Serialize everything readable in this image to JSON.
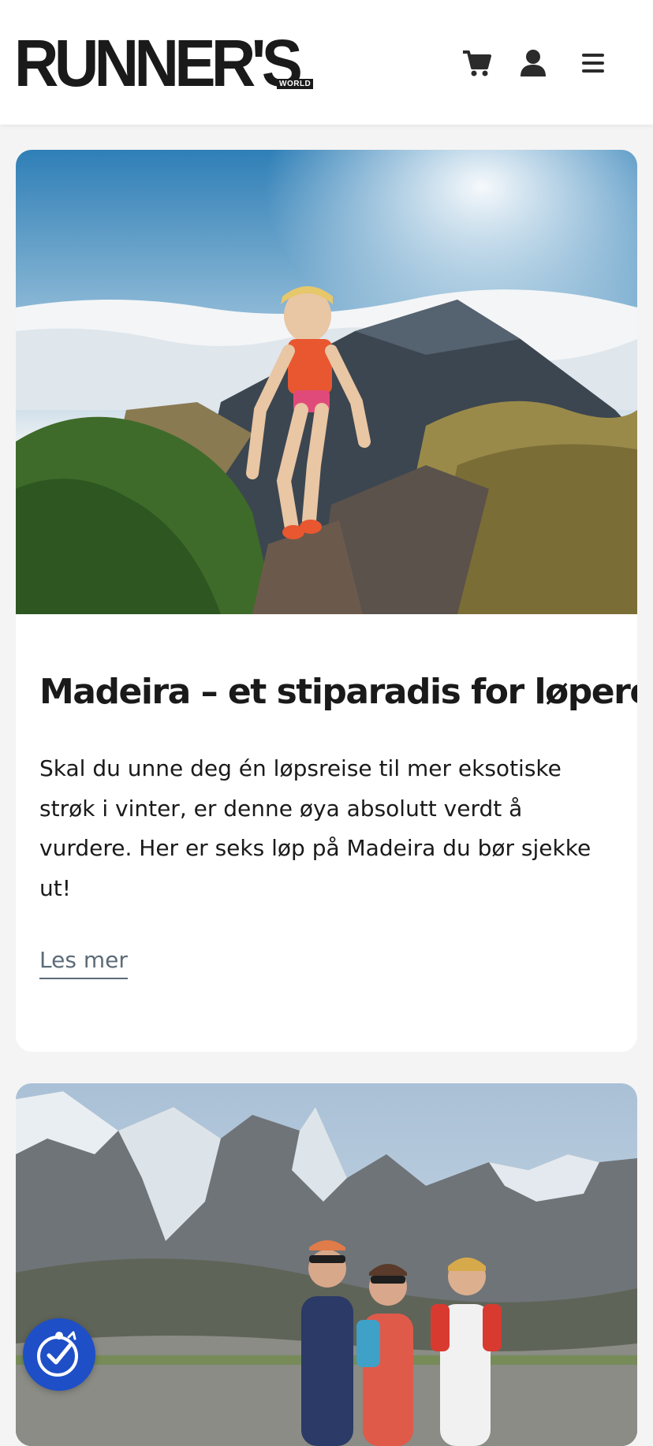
{
  "header": {
    "logo_text": "RUNNER'S",
    "logo_sub": "WORLD",
    "icons": [
      "cart-icon",
      "user-icon",
      "menu-icon"
    ]
  },
  "articles": [
    {
      "title": "Madeira – et stiparadis for løpere",
      "excerpt": "Skal du unne deg én løpsreise til mer eksotiske strøk i vinter, er denne øya absolutt verdt å vurdere. Her er seks løp på Madeira du bør sjekke ut!",
      "read_more": "Les mer",
      "image": "trail-runner-mountain-photo"
    },
    {
      "image": "hikers-alps-photo"
    }
  ],
  "accessibility": {
    "icon": "accessibility-icon"
  },
  "colors": {
    "accent_link": "#5d6b78",
    "accessibility_button": "#1e4fc7",
    "background": "#f4f4f4"
  }
}
